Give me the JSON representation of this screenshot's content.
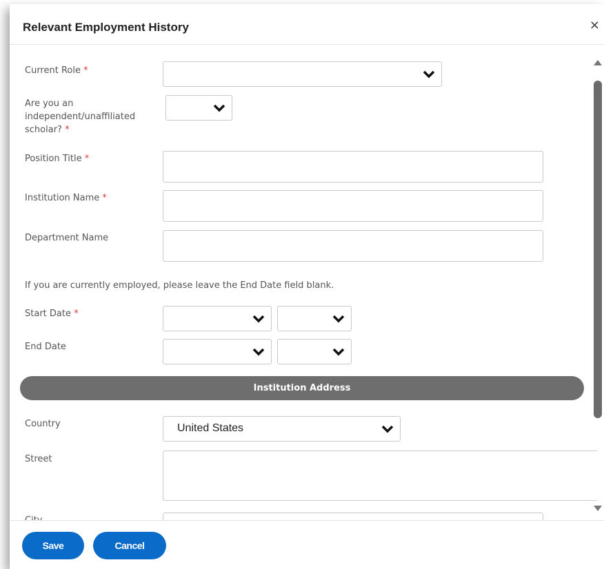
{
  "dialog": {
    "title": "Relevant Employment History",
    "close_label": "×"
  },
  "form": {
    "current_role": {
      "label": "Current Role",
      "required": "*",
      "value": ""
    },
    "independent_scholar": {
      "label_lines": [
        "Are you an",
        "independent/unaffiliated",
        "scholar?"
      ],
      "required": "*",
      "value": ""
    },
    "position_title": {
      "label": "Position Title",
      "required": "*",
      "value": ""
    },
    "institution_name": {
      "label": "Institution Name",
      "required": "*",
      "value": ""
    },
    "department_name": {
      "label": "Department Name",
      "value": ""
    },
    "note": "If you are currently employed, please leave the End Date field blank.",
    "start_date": {
      "label": "Start Date",
      "required": "*",
      "month": "",
      "year": ""
    },
    "end_date": {
      "label": "End Date",
      "month": "",
      "year": ""
    }
  },
  "address_section": {
    "title": "Institution Address",
    "country": {
      "label": "Country",
      "value": "United States"
    },
    "street": {
      "label": "Street",
      "value": ""
    },
    "city": {
      "label": "City",
      "value": ""
    }
  },
  "footer": {
    "save_label": "Save",
    "cancel_label": "Cancel"
  },
  "colors": {
    "accent": "#0a6cc8",
    "required": "#d9383a",
    "section_bar": "#6e6e6e"
  },
  "icons": {
    "close": "close-icon",
    "dropdown": "chevron-down-icon",
    "scroll_up": "arrow-up-icon",
    "scroll_down": "arrow-down-icon"
  }
}
